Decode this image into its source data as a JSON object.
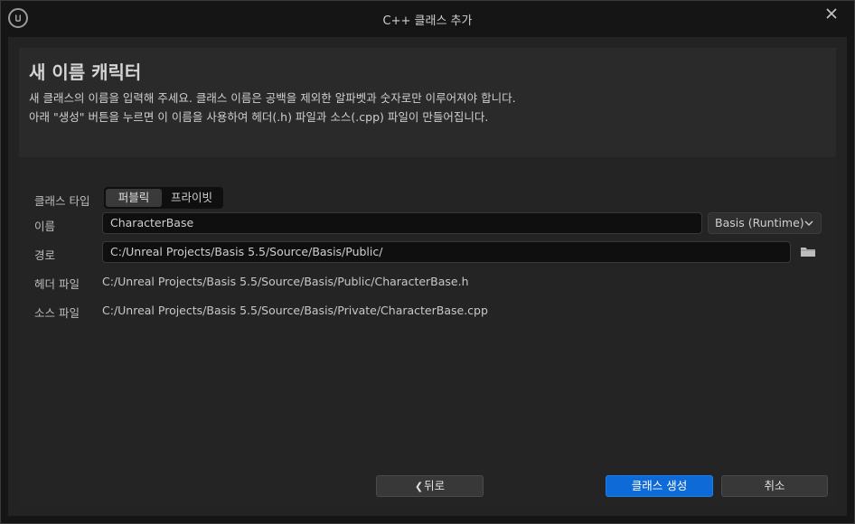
{
  "window": {
    "title": "C++ 클래스 추가",
    "logo_icon": "unreal-engine-logo",
    "close_icon": "close-icon"
  },
  "header": {
    "title": "새 이름 캐릭터",
    "description_line1": "새 클래스의 이름을 입력해 주세요. 클래스 이름은 공백을 제외한 알파벳과 숫자로만 이루어져야 합니다.",
    "description_line2": "아래 \"생성\" 버튼을 누르면 이 이름을 사용하여 헤더(.h) 파일과 소스(.cpp) 파일이 만들어집니다."
  },
  "form": {
    "class_type_label": "클래스 타입",
    "class_type_options": [
      "퍼블릭",
      "프라이빗"
    ],
    "class_type_selected": "퍼블릭",
    "name_label": "이름",
    "name_value": "CharacterBase",
    "module_value": "Basis (Runtime)",
    "path_label": "경로",
    "path_value": "C:/Unreal Projects/Basis 5.5/Source/Basis/Public/",
    "header_file_label": "헤더 파일",
    "header_file_value": "C:/Unreal Projects/Basis 5.5/Source/Basis/Public/CharacterBase.h",
    "source_file_label": "소스 파일",
    "source_file_value": "C:/Unreal Projects/Basis 5.5/Source/Basis/Private/CharacterBase.cpp"
  },
  "footer": {
    "back_label": "뒤로",
    "create_label": "클래스 생성",
    "cancel_label": "취소"
  },
  "colors": {
    "accent": "#0e6ad6",
    "background": "#151515",
    "panel": "#242424"
  }
}
